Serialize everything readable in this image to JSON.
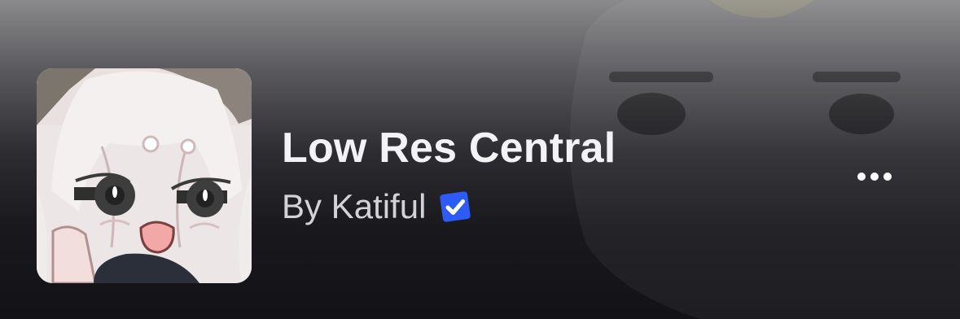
{
  "group": {
    "name": "Low Res Central",
    "byline": "By Katiful",
    "owner": "Katiful",
    "verified": true
  },
  "icons": {
    "avatar": "group-avatar-icon",
    "verified": "verified-checkmark-icon",
    "more": "more-options-icon"
  },
  "colors": {
    "verified_badge": "#2d5bf5",
    "title_text": "#f3f3f5",
    "byline_text": "#d2d2d8"
  }
}
